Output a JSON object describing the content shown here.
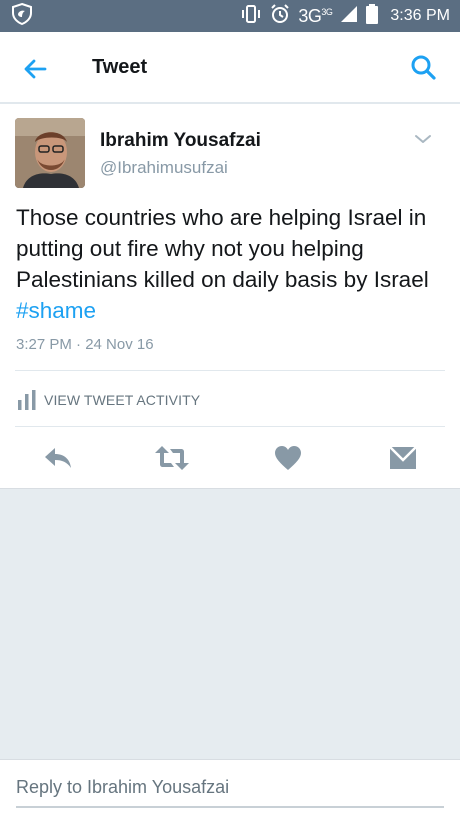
{
  "status_bar": {
    "network": "3G",
    "network_sup": "3G",
    "time": "3:36 PM",
    "icons": [
      "shield-app-icon",
      "vibrate-icon",
      "alarm-icon",
      "signal-icon",
      "battery-icon"
    ]
  },
  "app_bar": {
    "title": "Tweet",
    "back_icon": "arrow-left-icon",
    "search_icon": "search-icon"
  },
  "tweet": {
    "user_name": "Ibrahim Yousafzai",
    "handle": "@Ibrahimusufzai",
    "text": "Those countries who are helping Israel in putting out fire why not you helping Palestinians killed on daily basis by Israel",
    "hashtag": "#shame",
    "timestamp": "3:27 PM · 24 Nov 16",
    "activity_label": "VIEW TWEET ACTIVITY",
    "actions": [
      "reply-icon",
      "retweet-icon",
      "like-icon",
      "direct-message-icon"
    ]
  },
  "composer": {
    "placeholder": "Reply to Ibrahim Yousafzai",
    "value": ""
  },
  "colors": {
    "status_bar": "#5b6e82",
    "accent": "#1da1f2",
    "icon_gray": "#8899a6",
    "text": "#14171a",
    "background_gray": "#e6ecf0"
  }
}
